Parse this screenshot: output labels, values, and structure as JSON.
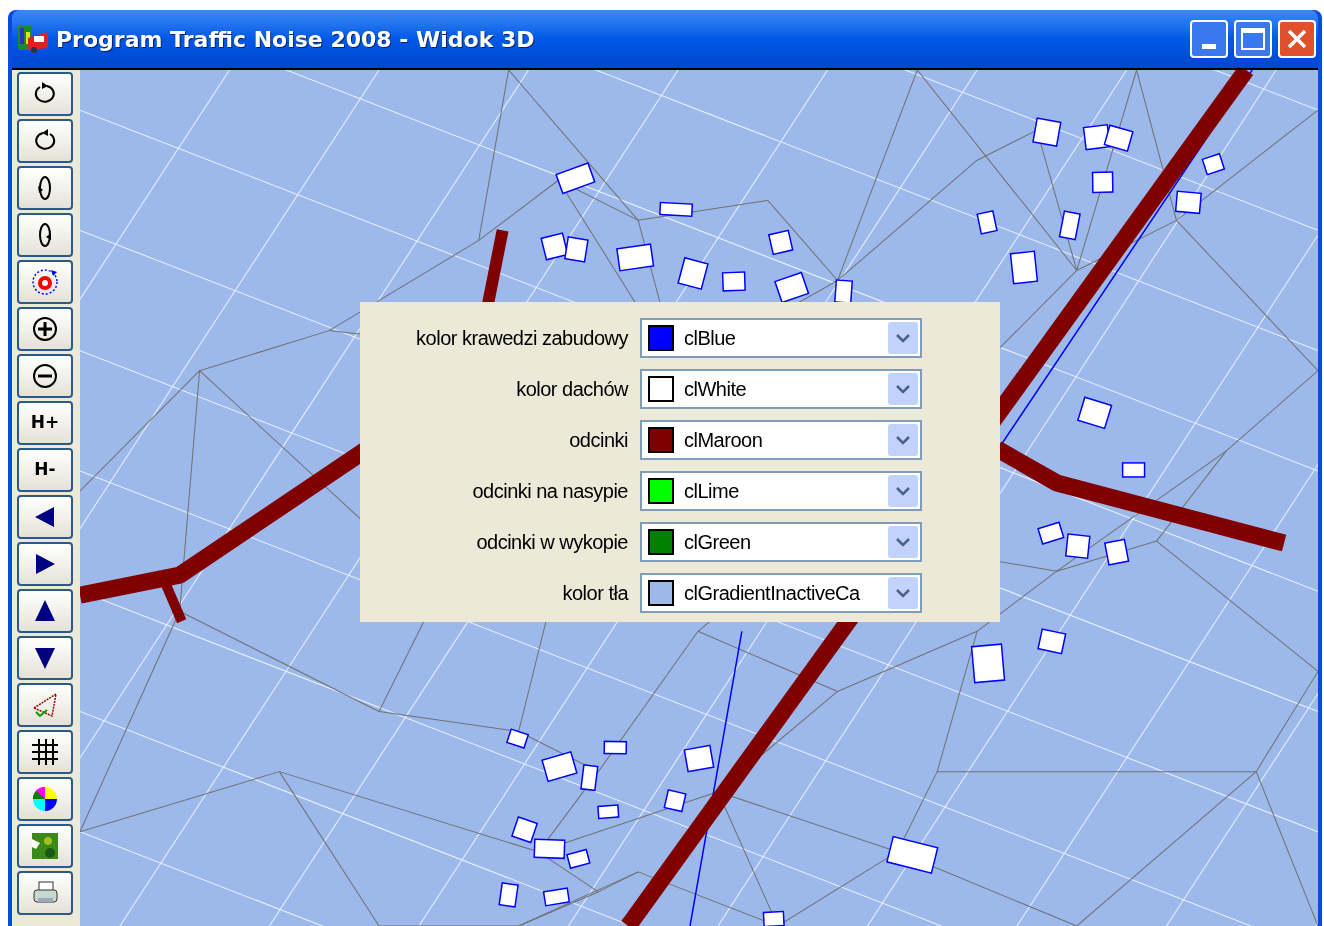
{
  "window": {
    "title": "Program Traffic Noise 2008 - Widok 3D"
  },
  "toolbar": [
    {
      "kind": "icon"
    },
    {
      "kind": "icon"
    },
    {
      "kind": "icon"
    },
    {
      "kind": "icon"
    },
    {
      "kind": "icon"
    },
    {
      "kind": "icon"
    },
    {
      "kind": "icon"
    },
    {
      "kind": "text",
      "label": "H+"
    },
    {
      "kind": "text",
      "label": "H-"
    },
    {
      "kind": "icon"
    },
    {
      "kind": "icon"
    },
    {
      "kind": "icon"
    },
    {
      "kind": "icon"
    },
    {
      "kind": "icon"
    },
    {
      "kind": "icon"
    },
    {
      "kind": "icon"
    },
    {
      "kind": "icon"
    },
    {
      "kind": "icon"
    }
  ],
  "color_settings": [
    {
      "label": "kolor krawedzi zabudowy",
      "value": "clBlue",
      "color": "#0000ff"
    },
    {
      "label": "kolor dachów",
      "value": "clWhite",
      "color": "#ffffff"
    },
    {
      "label": "odcinki",
      "value": "clMaroon",
      "color": "#800000"
    },
    {
      "label": "odcinki na nasypie",
      "value": "clLime",
      "color": "#00ff00"
    },
    {
      "label": "odcinki w wykopie",
      "value": "clGreen",
      "color": "#008000"
    },
    {
      "label": "kolor tła",
      "value": "clGradientInactiveCa",
      "color": "#9db9eb"
    }
  ]
}
